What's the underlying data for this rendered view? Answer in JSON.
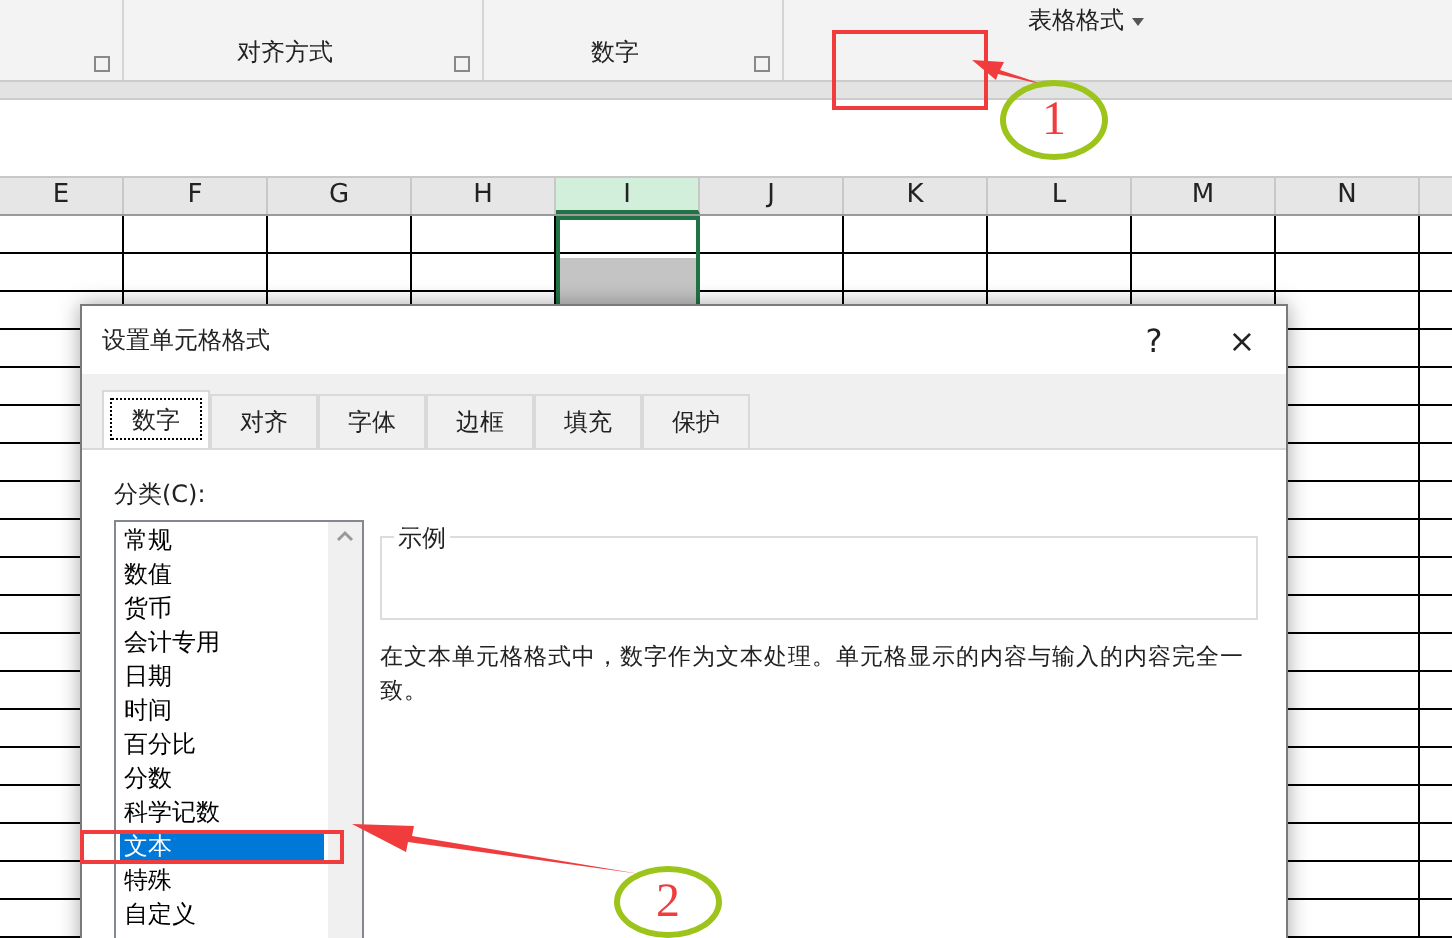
{
  "ribbon": {
    "groups": [
      {
        "label": "对齐方式"
      },
      {
        "label": "数字"
      }
    ],
    "table_format_button": "表格格式"
  },
  "sheet": {
    "columns": [
      {
        "label": "E",
        "selected": false
      },
      {
        "label": "F",
        "selected": false
      },
      {
        "label": "G",
        "selected": false
      },
      {
        "label": "H",
        "selected": false
      },
      {
        "label": "I",
        "selected": true
      },
      {
        "label": "J",
        "selected": false
      },
      {
        "label": "K",
        "selected": false
      },
      {
        "label": "L",
        "selected": false
      },
      {
        "label": "M",
        "selected": false
      },
      {
        "label": "N",
        "selected": false
      }
    ]
  },
  "dialog": {
    "title": "设置单元格格式",
    "help": "?",
    "close": "×",
    "tabs": [
      {
        "label": "数字",
        "selected": true
      },
      {
        "label": "对齐",
        "selected": false
      },
      {
        "label": "字体",
        "selected": false
      },
      {
        "label": "边框",
        "selected": false
      },
      {
        "label": "填充",
        "selected": false
      },
      {
        "label": "保护",
        "selected": false
      }
    ],
    "category_label": "分类(C):",
    "categories": [
      {
        "label": "常规",
        "selected": false
      },
      {
        "label": "数值",
        "selected": false
      },
      {
        "label": "货币",
        "selected": false
      },
      {
        "label": "会计专用",
        "selected": false
      },
      {
        "label": "日期",
        "selected": false
      },
      {
        "label": "时间",
        "selected": false
      },
      {
        "label": "百分比",
        "selected": false
      },
      {
        "label": "分数",
        "selected": false
      },
      {
        "label": "科学记数",
        "selected": false
      },
      {
        "label": "文本",
        "selected": true
      },
      {
        "label": "特殊",
        "selected": false
      },
      {
        "label": "自定义",
        "selected": false
      }
    ],
    "sample_label": "示例",
    "description": "在文本单元格格式中，数字作为文本处理。单元格显示的内容与输入的内容完全一致。"
  },
  "annotations": [
    {
      "number": "1"
    },
    {
      "number": "2"
    }
  ]
}
